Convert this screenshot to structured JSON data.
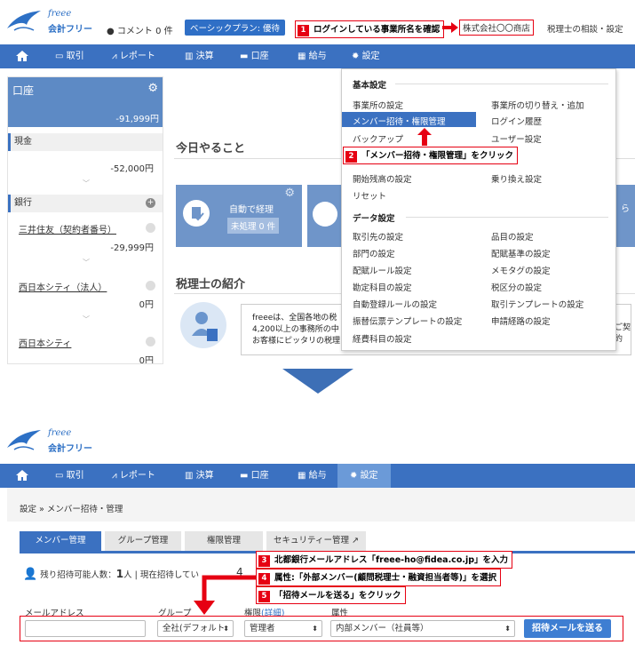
{
  "top": {
    "logo": {
      "script": "freee",
      "label": "会計フリー"
    },
    "comment": "コメント 0 件",
    "plan": "ベーシックプラン: 優待",
    "step1": {
      "num": "1",
      "text": "ログインしている事業所名を確認"
    },
    "office": "株式会社〇〇商店",
    "tax_link": "税理士の相談・設定",
    "nav": [
      "取引",
      "レポート",
      "決算",
      "口座",
      "給与",
      "設定"
    ],
    "sidebar": {
      "header": {
        "title": "口座",
        "amount": "-91,999円"
      },
      "cash": {
        "label": "現金",
        "amount": "-52,000円"
      },
      "bank": {
        "label": "銀行"
      },
      "accounts": [
        {
          "name": "三井住友（契約者番号）",
          "amount": "-29,999円"
        },
        {
          "name": "西日本シティ（法人）",
          "amount": "0円"
        },
        {
          "name": "西日本シティ",
          "amount": "0円"
        }
      ]
    },
    "main": {
      "todo_title": "今日やること",
      "auto_label": "自動で経理",
      "unprocessed": "未処理 0 件",
      "tax_title": "税理士の紹介",
      "bubble": [
        "freeeは、全国各地の税",
        "4,200以上の事務所の中",
        "お客様にピッタリの税理"
      ],
      "clip_right": "ら",
      "clip_right2": "ご契約"
    },
    "dropdown": {
      "basic_header": "基本設定",
      "left": [
        "事業所の設定",
        "メンバー招待・権限管理",
        "バックアップ",
        "",
        "開始残高の設定",
        "リセット"
      ],
      "right": [
        "事業所の切り替え・追加",
        "ログイン履歴",
        "ユーザー設定",
        "",
        "乗り換え設定"
      ],
      "data_header": "データ設定",
      "data_left": [
        "取引先の設定",
        "部門の設定",
        "配賦ルール設定",
        "勘定科目の設定",
        "自動登録ルールの設定",
        "振替伝票テンプレートの設定",
        "経費科目の設定"
      ],
      "data_right": [
        "品目の設定",
        "配賦基準の設定",
        "メモタグの設定",
        "税区分の設定",
        "取引テンプレートの設定",
        "申請経路の設定"
      ]
    },
    "step2": {
      "num": "2",
      "text": "「メンバー招待・権限管理」をクリック"
    }
  },
  "bottom": {
    "logo": {
      "script": "freee",
      "label": "会計フリー"
    },
    "nav": [
      "取引",
      "レポート",
      "決算",
      "口座",
      "給与",
      "設定"
    ],
    "breadcrumb": "設定 » メンバー招待・管理",
    "tabs": [
      "メンバー管理",
      "グループ管理",
      "権限管理",
      "セキュリティー管理"
    ],
    "remaining": "残り招待可能人数：",
    "remaining_val": "1",
    "remaining_rest": "人 | 現在招待してい",
    "remaining_tail": "4",
    "step3": {
      "num": "3",
      "text": "北都銀行メールアドレス「freee-ho@fidea.co.jp」を入力"
    },
    "step4": {
      "num": "4",
      "text": "属性:「外部メンバー(顧問税理士・融資担当者等)」を選択"
    },
    "step5": {
      "num": "5",
      "text": "「招待メールを送る」をクリック"
    },
    "form": {
      "email_label": "メールアドレス",
      "group_label": "グループ",
      "role_label": "権限",
      "role_detail": "(詳細)",
      "attr_label": "属性",
      "email_value": "",
      "group_value": "全社(デフォルト",
      "role_value": "管理者",
      "attr_value": "内部メンバー（社員等）",
      "send_label": "招待メールを送る"
    }
  },
  "colors": {
    "nav": "#3b71c1",
    "red": "#e60012",
    "arrow": "#3d6fb6"
  }
}
